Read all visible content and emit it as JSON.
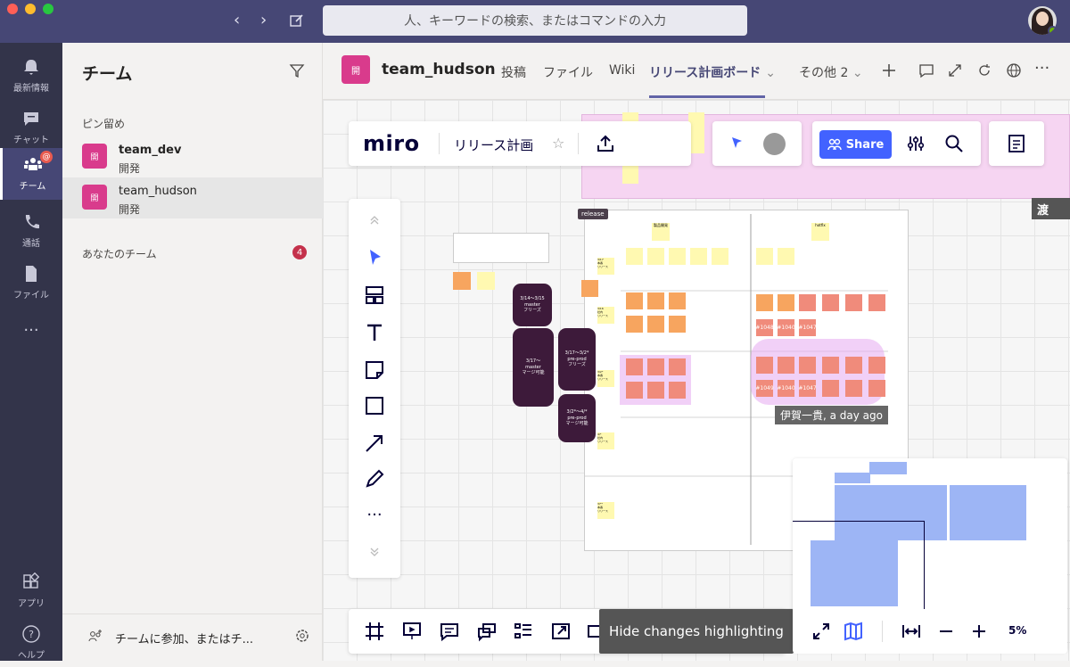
{
  "window": {
    "search_placeholder": "人、キーワードの検索、またはコマンドの入力",
    "traffic_colors": [
      "#ff5f57",
      "#febc2e",
      "#28c840"
    ]
  },
  "rail": {
    "items": [
      {
        "label": "最新情報",
        "icon": "bell-icon"
      },
      {
        "label": "チャット",
        "icon": "chat-icon"
      },
      {
        "label": "チーム",
        "icon": "teams-icon",
        "badge": "@"
      },
      {
        "label": "通話",
        "icon": "phone-icon"
      },
      {
        "label": "ファイル",
        "icon": "file-icon"
      },
      {
        "label": "...",
        "icon": "more-icon"
      },
      {
        "label": "アプリ",
        "icon": "apps-icon"
      },
      {
        "label": "ヘルプ",
        "icon": "help-icon"
      }
    ]
  },
  "teams_panel": {
    "title": "チーム",
    "pinned_label": "ピン留め",
    "pinned": [
      {
        "name": "team_dev",
        "sub": "開発",
        "avatar": "開"
      },
      {
        "name": "team_hudson",
        "sub": "開発",
        "avatar": "開"
      }
    ],
    "your_teams_label": "あなたのチーム",
    "your_teams_count": "4",
    "join_label": "チームに参加、またはチ..."
  },
  "channel": {
    "avatar": "開",
    "name": "team_hudson",
    "tabs": [
      "投稿",
      "ファイル",
      "Wiki",
      "リリース計画ボード",
      "その他 2"
    ],
    "active_tab": "リリース計画ボード"
  },
  "miro": {
    "logo": "miro",
    "board_name": "リリース計画",
    "share_label": "Share",
    "frame_tag": "release",
    "side_label": "渡",
    "cursor_label": "伊賀一貴, a day ago",
    "tooltip": "Hide changes highlighting",
    "zoom": "5%",
    "frame_headers": [
      "製品開発",
      "hotfix"
    ],
    "pills": [
      "3/14〜3/15\nmaster\nフリーズ",
      "3/17〜\nmaster\nマージ可能",
      "3/17〜3/2*\npre-prod\nフリーズ",
      "3/2*〜4/*\npre-prod\nマージ可能"
    ],
    "issue_labels": [
      "#1048",
      "#1040",
      "#1047",
      "#1049",
      "#1040",
      "#1047"
    ],
    "release_notes": [
      "3/17\n本番\nリリース",
      "3/16\n社内\nリリース",
      "3/2*\n本番\nリリース",
      "4/*\n社内\nリリース",
      "3/**\n本番\nリリース"
    ]
  }
}
